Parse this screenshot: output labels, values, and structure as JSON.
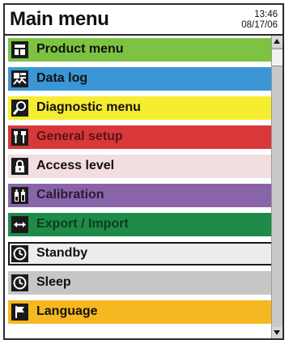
{
  "header": {
    "title": "Main menu",
    "time": "13:46",
    "date": "08/17/06"
  },
  "menu": {
    "items": [
      {
        "label": "Product menu",
        "icon": "product-icon",
        "bg": "#7dc242",
        "fg": "#111111"
      },
      {
        "label": "Data log",
        "icon": "data-log-icon",
        "bg": "#3b96d6",
        "fg": "#111111"
      },
      {
        "label": "Diagnostic menu",
        "icon": "magnifier-icon",
        "bg": "#f6ec32",
        "fg": "#111111"
      },
      {
        "label": "General setup",
        "icon": "tools-icon",
        "bg": "#d8383a",
        "fg": "#5a1414"
      },
      {
        "label": "Access level",
        "icon": "lock-icon",
        "bg": "#f2dde0",
        "fg": "#111111"
      },
      {
        "label": "Calibration",
        "icon": "calibration-icon",
        "bg": "#8a64a8",
        "fg": "#2a1a3a"
      },
      {
        "label": "Export / Import",
        "icon": "transfer-icon",
        "bg": "#1e8c48",
        "fg": "#0f3a1e"
      },
      {
        "label": "Standby",
        "icon": "clock-icon",
        "bg": "#ececec",
        "fg": "#111111",
        "selected": true
      },
      {
        "label": "Sleep",
        "icon": "clock-icon",
        "bg": "#c6c6c6",
        "fg": "#111111"
      },
      {
        "label": "Language",
        "icon": "flag-icon",
        "bg": "#f6b820",
        "fg": "#111111"
      }
    ]
  }
}
